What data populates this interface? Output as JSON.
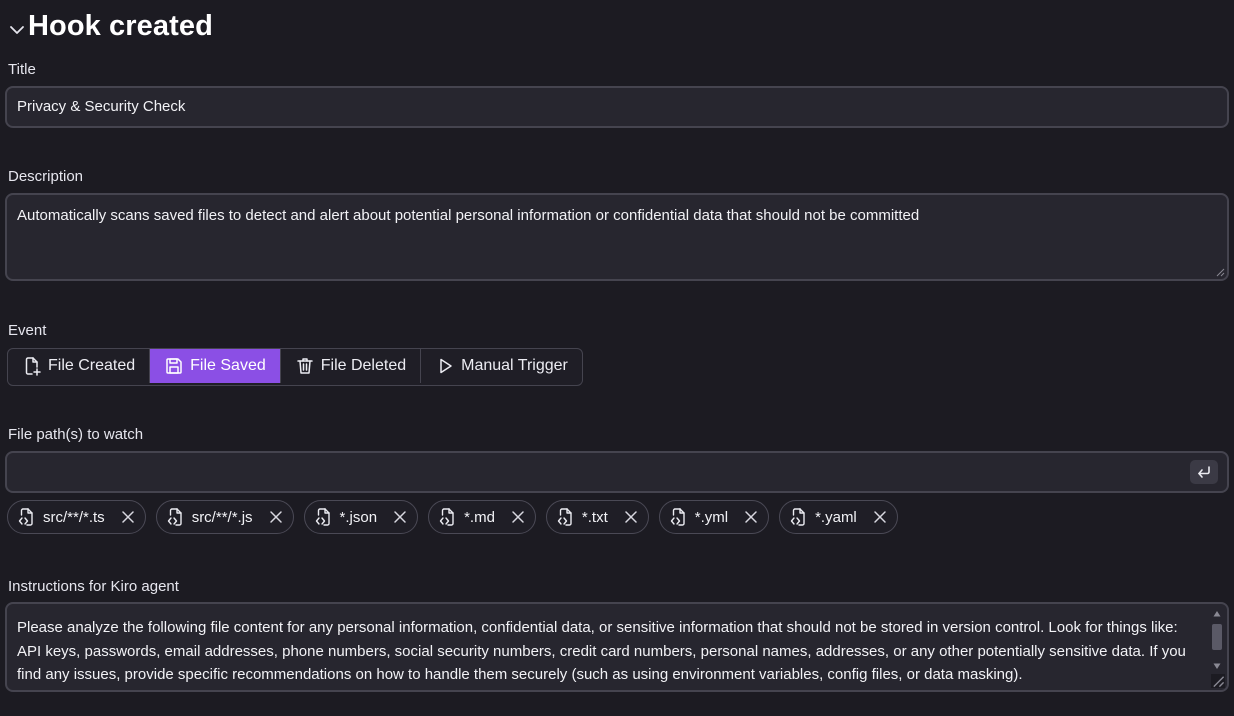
{
  "header": {
    "title": "Hook created"
  },
  "title_field": {
    "label": "Title",
    "value": "Privacy & Security Check"
  },
  "description_field": {
    "label": "Description",
    "value": "Automatically scans saved files to detect and alert about potential personal information or confidential data that should not be committed"
  },
  "event": {
    "label": "Event",
    "options": [
      {
        "label": "File Created",
        "icon": "file-plus-icon",
        "selected": false
      },
      {
        "label": "File Saved",
        "icon": "save-icon",
        "selected": true
      },
      {
        "label": "File Deleted",
        "icon": "trash-icon",
        "selected": false
      },
      {
        "label": "Manual Trigger",
        "icon": "play-icon",
        "selected": false
      }
    ]
  },
  "file_paths": {
    "label": "File path(s) to watch",
    "input_value": "",
    "chips": [
      "src/**/*.ts",
      "src/**/*.js",
      "*.json",
      "*.md",
      "*.txt",
      "*.yml",
      "*.yaml"
    ]
  },
  "instructions": {
    "label": "Instructions for Kiro agent",
    "value": "Please analyze the following file content for any personal information, confidential data, or sensitive information that should not be stored in version control. Look for things like: API keys, passwords, email addresses, phone numbers, social security numbers, credit card numbers, personal names, addresses, or any other potentially sensitive data. If you find any issues, provide specific recommendations on how to handle them securely (such as using environment variables, config files, or data masking)."
  },
  "colors": {
    "accent": "#8b4fe5",
    "background": "#1c1b22",
    "field": "#27262f",
    "border": "#45444f"
  }
}
